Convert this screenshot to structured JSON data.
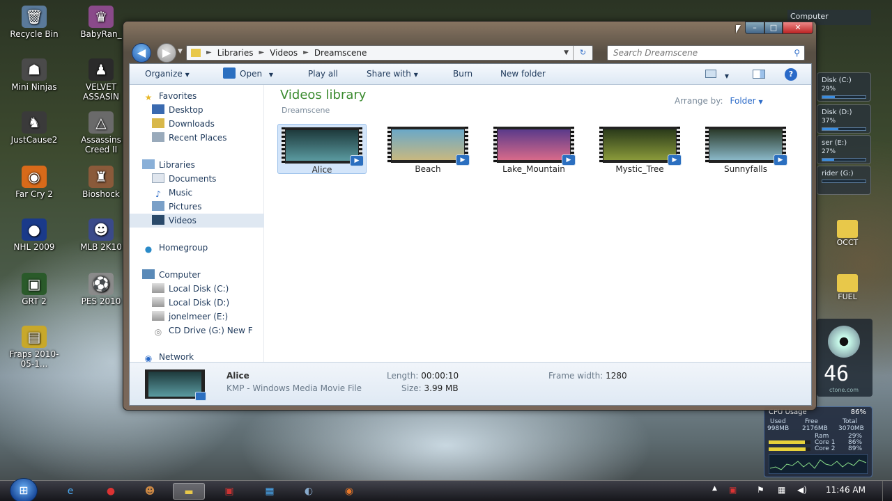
{
  "desktop_icons": [
    {
      "label": "Recycle Bin",
      "icon": "recycle-bin-icon",
      "glyph": "🗑"
    },
    {
      "label": "BabyRan_",
      "icon": "game-icon",
      "glyph": "♛"
    },
    {
      "label": "Mini Ninjas",
      "icon": "ninja-icon",
      "glyph": "☗"
    },
    {
      "label": "VELVET ASSASIN",
      "icon": "game-icon",
      "glyph": "♟"
    },
    {
      "label": "JustCause2",
      "icon": "game-icon",
      "glyph": "♞"
    },
    {
      "label": "Assassins Creed II",
      "icon": "game-icon",
      "glyph": "△"
    },
    {
      "label": "Far Cry 2",
      "icon": "farcry-icon",
      "glyph": "◉"
    },
    {
      "label": "Bioshock",
      "icon": "bioshock-icon",
      "glyph": "♜"
    },
    {
      "label": "NHL 2009",
      "icon": "ea-icon",
      "glyph": "●"
    },
    {
      "label": "MLB 2K10",
      "icon": "baseball-icon",
      "glyph": "☻"
    },
    {
      "label": "GRT 2",
      "icon": "game-icon",
      "glyph": "▣"
    },
    {
      "label": "PES 2010",
      "icon": "soccer-icon",
      "glyph": "⚽"
    },
    {
      "label": "Fraps 2010-05-1...",
      "icon": "folder-icon",
      "glyph": "▤"
    }
  ],
  "right_folders": [
    {
      "label": "OCCT"
    },
    {
      "label": "FUEL"
    }
  ],
  "gadgets": {
    "drives": [
      {
        "label": "Disk (C:)",
        "value": "29%",
        "fill": 0.29
      },
      {
        "label": "Disk (D:)",
        "value": "37%",
        "fill": 0.37
      },
      {
        "label": "ser (E:)",
        "value": "27%",
        "fill": 0.27
      },
      {
        "label": "rider (G:)",
        "value": "",
        "fill": 0
      }
    ],
    "computer_label": "Computer",
    "clock_number": "46",
    "clock_sub": "ctone.com",
    "cpu": {
      "title": "CPU Usage",
      "value": "86%",
      "used_label": "Used",
      "used": "998MB",
      "free_label": "Free",
      "free": "2176MB",
      "total_label": "Total",
      "total": "3070MB",
      "ram_label": "Ram",
      "ram": "29%",
      "core1_label": "Core 1",
      "core1": "86%",
      "core1_fill": 0.86,
      "core2_label": "Core 2",
      "core2": "89%",
      "core2_fill": 0.89
    }
  },
  "window": {
    "address": {
      "crumbs": [
        "Libraries",
        "Videos",
        "Dreamscene"
      ]
    },
    "search_placeholder": "Search Dreamscene",
    "toolbar": {
      "organize": "Organize",
      "open": "Open",
      "play_all": "Play all",
      "share_with": "Share with",
      "burn": "Burn",
      "new_folder": "New folder"
    },
    "nav": {
      "favorites": "Favorites",
      "fav_items": [
        "Desktop",
        "Downloads",
        "Recent Places"
      ],
      "libraries": "Libraries",
      "lib_items": [
        "Documents",
        "Music",
        "Pictures",
        "Videos"
      ],
      "homegroup": "Homegroup",
      "computer": "Computer",
      "comp_items": [
        "Local Disk (C:)",
        "Local Disk (D:)",
        "jonelmeer (E:)",
        "CD Drive (G:) New F"
      ],
      "network": "Network"
    },
    "library": {
      "title": "Videos library",
      "subtitle": "Dreamscene",
      "arrange_label": "Arrange by:",
      "arrange_value": "Folder"
    },
    "files": [
      {
        "name": "Alice",
        "colors": [
          "#1e3a3c",
          "#5a9aa0"
        ]
      },
      {
        "name": "Beach",
        "colors": [
          "#6aa8c8",
          "#c8b880"
        ]
      },
      {
        "name": "Lake_Mountain",
        "colors": [
          "#5a3a8a",
          "#d86a8a"
        ]
      },
      {
        "name": "Mystic_Tree",
        "colors": [
          "#2a3a1a",
          "#8a9a3a"
        ]
      },
      {
        "name": "Sunnyfalls",
        "colors": [
          "#2a3a2a",
          "#8ab8c8"
        ]
      }
    ],
    "details": {
      "name": "Alice",
      "type": "KMP - Windows Media Movie File",
      "length_label": "Length:",
      "length": "00:00:10",
      "size_label": "Size:",
      "size": "3.99 MB",
      "frame_label": "Frame width:",
      "frame": "1280"
    }
  },
  "taskbar": {
    "time": "11:46 AM"
  }
}
